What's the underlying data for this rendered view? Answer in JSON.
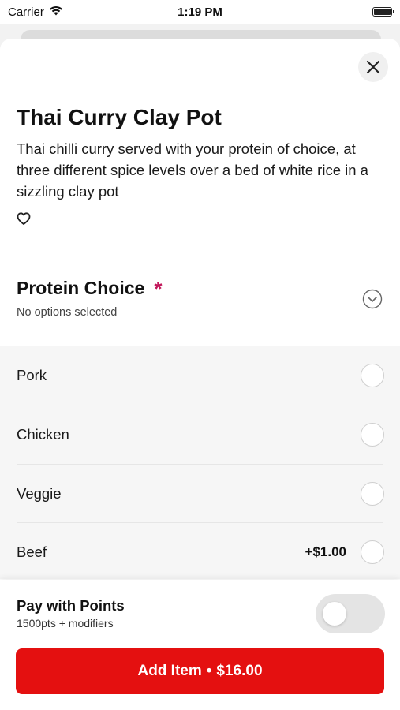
{
  "status_bar": {
    "carrier": "Carrier",
    "time": "1:19 PM"
  },
  "item": {
    "title": "Thai Curry Clay Pot",
    "description": "Thai chilli curry served with your protein of choice, at three different spice levels over a bed of white rice in a sizzling clay pot"
  },
  "modifier_group": {
    "title": "Protein Choice",
    "required_mark": "*",
    "subtitle": "No options selected",
    "options": [
      {
        "label": "Pork",
        "price": ""
      },
      {
        "label": "Chicken",
        "price": ""
      },
      {
        "label": "Veggie",
        "price": ""
      },
      {
        "label": "Beef",
        "price": "+$1.00"
      }
    ]
  },
  "points": {
    "title": "Pay with Points",
    "subtitle": "1500pts + modifiers",
    "enabled": false
  },
  "cart": {
    "add_label": "Add Item",
    "separator": "•",
    "total": "$16.00"
  },
  "colors": {
    "accent": "#e41010",
    "required": "#c2185b"
  },
  "icons": {
    "close": "close-icon",
    "favorite": "heart-outline-icon",
    "expand": "chevron-down-circle-icon",
    "wifi": "wifi-icon",
    "battery": "battery-icon"
  }
}
